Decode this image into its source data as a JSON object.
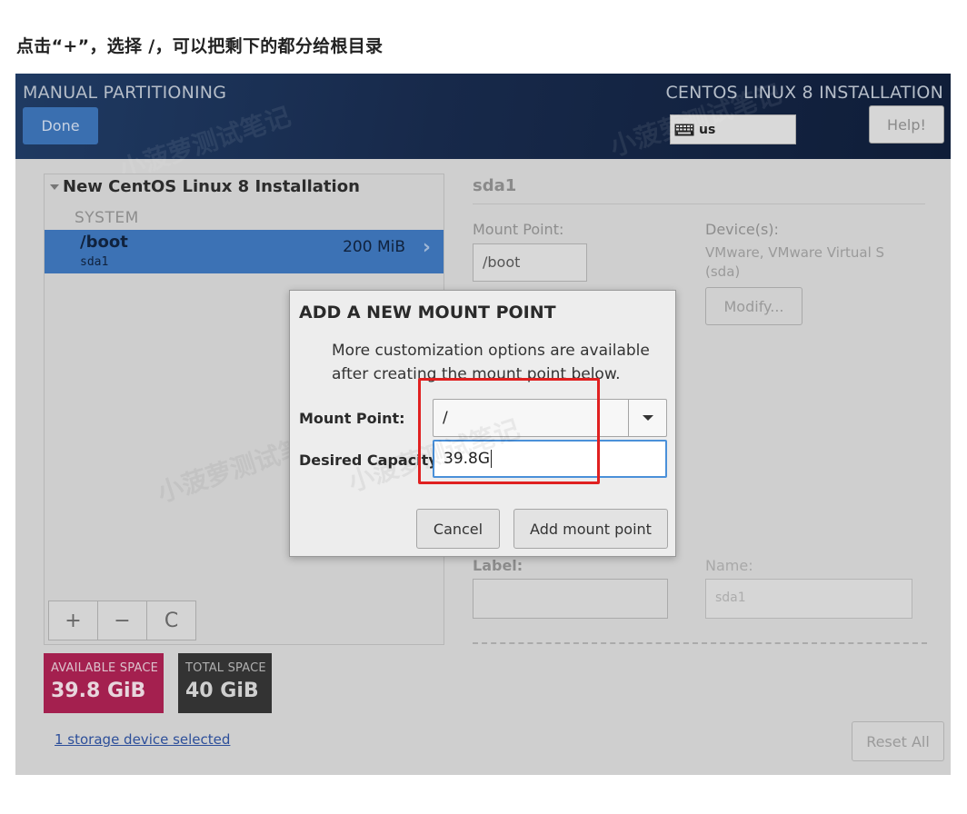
{
  "caption": "点击“+”，选择 /，可以把剩下的都分给根目录",
  "header": {
    "title": "MANUAL PARTITIONING",
    "done_label": "Done",
    "os_title": "CENTOS LINUX 8 INSTALLATION",
    "keyboard_layout": "us",
    "help_label": "Help!"
  },
  "watermark": {
    "a": "小菠萝测试笔记",
    "b": "小菠萝测试笔记",
    "c": "小菠萝测试笔记",
    "d": "小菠萝测试笔记"
  },
  "partitions": {
    "group_title": "New CentOS Linux 8 Installation",
    "section_label": "SYSTEM",
    "items": [
      {
        "mount": "/boot",
        "device": "sda1",
        "size": "200 MiB"
      }
    ],
    "tools": {
      "add": "+",
      "remove": "−",
      "refresh": "C"
    }
  },
  "space": {
    "available_label": "AVAILABLE SPACE",
    "available_value": "39.8 GiB",
    "total_label": "TOTAL SPACE",
    "total_value": "40 GiB"
  },
  "storage_link": "1 storage device selected",
  "details": {
    "title": "sda1",
    "mount_point_label": "Mount Point:",
    "mount_point_value": "/boot",
    "devices_label": "Device(s):",
    "devices_value": "VMware, VMware Virtual S (sda)",
    "modify_label": "Modify...",
    "label_label": "Label:",
    "name_label": "Name:",
    "name_value": "sda1",
    "reset_label": "Reset All"
  },
  "dialog": {
    "title": "ADD A NEW MOUNT POINT",
    "info": "More customization options are available after creating the mount point below.",
    "mount_point_label": "Mount Point:",
    "mount_point_value": "/",
    "capacity_label": "Desired Capacity:",
    "capacity_value": "39.8G",
    "cancel_label": "Cancel",
    "add_label": "Add mount point"
  },
  "colors": {
    "accent": "#3c72b5",
    "available": "#a4204f",
    "total": "#333333",
    "highlight": "#e02020"
  }
}
